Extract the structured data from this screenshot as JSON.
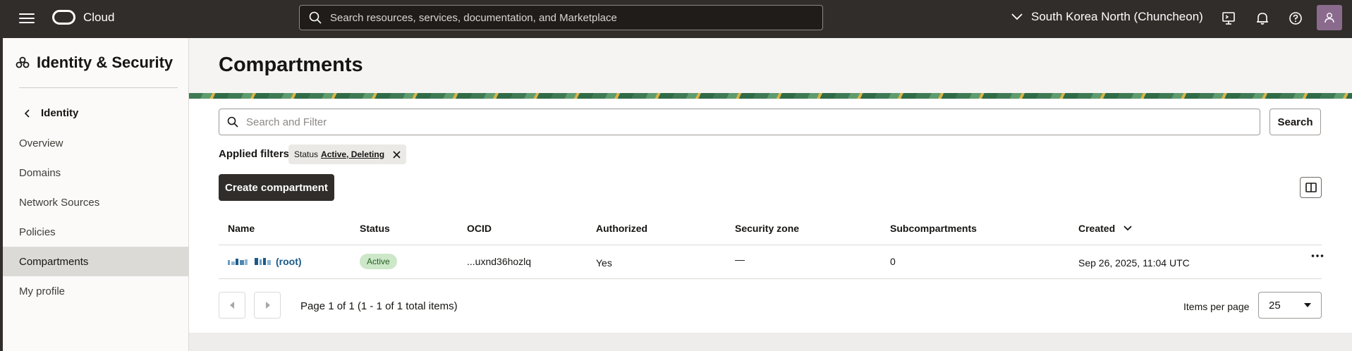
{
  "topbar": {
    "app_name": "Cloud",
    "search_placeholder": "Search resources, services, documentation, and Marketplace",
    "region": "South Korea North (Chuncheon)"
  },
  "sidebar": {
    "title": "Identity & Security",
    "back_label": "Identity",
    "items": [
      {
        "label": "Overview"
      },
      {
        "label": "Domains"
      },
      {
        "label": "Network Sources"
      },
      {
        "label": "Policies"
      },
      {
        "label": "Compartments"
      },
      {
        "label": "My profile"
      }
    ],
    "active_item": "Compartments"
  },
  "main": {
    "title": "Compartments",
    "filter_placeholder": "Search and Filter",
    "search_button": "Search",
    "applied_filters_label": "Applied filters",
    "filter_chip": {
      "key": "Status",
      "value": "Active, Deleting"
    },
    "create_button": "Create compartment",
    "table": {
      "columns": [
        "Name",
        "Status",
        "OCID",
        "Authorized",
        "Security zone",
        "Subcompartments",
        "Created"
      ],
      "rows": [
        {
          "name_suffix": "(root)",
          "status": "Active",
          "ocid": "...uxnd36hozlq",
          "authorized": "Yes",
          "security_zone": "—",
          "subcompartments": "0",
          "created": "Sep 26, 2025, 11:04 UTC"
        }
      ]
    },
    "pagination": {
      "text": "Page 1 of 1 (1 - 1 of 1 total items)",
      "items_per_page_label": "Items per page",
      "items_per_page": "25"
    }
  },
  "colors": {
    "topbar_bg": "#312d2a",
    "link": "#1a5a8a",
    "active_badge_bg": "#cde7c9",
    "primary_button_bg": "#312d2a"
  }
}
